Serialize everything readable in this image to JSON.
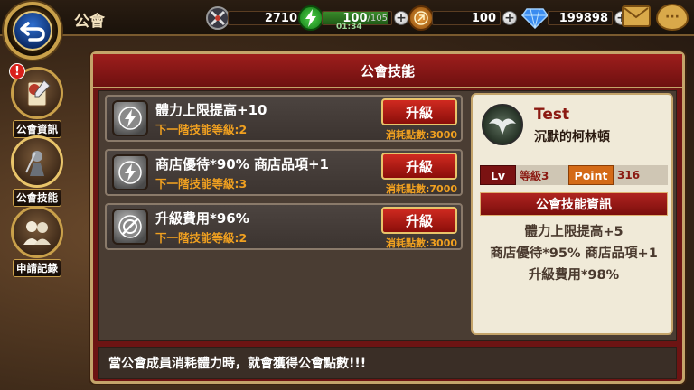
{
  "header": {
    "title": "公會",
    "stamina_points": "2710",
    "energy_current": "100",
    "energy_max": "/105",
    "energy_timer": "01:34",
    "energy_fill": 0.95,
    "coin_points": "100",
    "gems": "199898"
  },
  "sidebar": {
    "items": [
      {
        "label": "公會資訊",
        "icon": "guild-info-icon",
        "alert": "!"
      },
      {
        "label": "公會技能",
        "icon": "guild-skill-icon"
      },
      {
        "label": "申請記錄",
        "icon": "application-record-icon"
      }
    ]
  },
  "panel": {
    "title": "公會技能",
    "skills": [
      {
        "name": "體力上限提高+10",
        "next_level": "下一階技能等級:2",
        "button": "升級",
        "cost": "消耗點數:3000",
        "icon": "lightning-skill-icon"
      },
      {
        "name": "商店優待*90% 商店品項+1",
        "next_level": "下一階技能等級:3",
        "button": "升級",
        "cost": "消耗點數:7000",
        "icon": "lightning-skill-icon"
      },
      {
        "name": "升級費用*96%",
        "next_level": "下一階技能等級:2",
        "button": "升級",
        "cost": "消耗點數:3000",
        "icon": "no-cost-skill-icon"
      }
    ],
    "footer": "當公會成員消耗體力時，就會獲得公會點數!!!"
  },
  "guild": {
    "name": "Test",
    "description": "沉默的柯林頓",
    "lv_label": "Lv",
    "lv_value": "等級3",
    "point_label": "Point",
    "point_value": "316",
    "info_title": "公會技能資訊",
    "info_lines": [
      "體力上限提高+5",
      "商店優待*95% 商店品項+1",
      "升級費用*98%"
    ]
  },
  "colors": {
    "panel_red": "#6d1413",
    "gold_border": "#c4a46a",
    "orange_text": "#f0a020"
  }
}
